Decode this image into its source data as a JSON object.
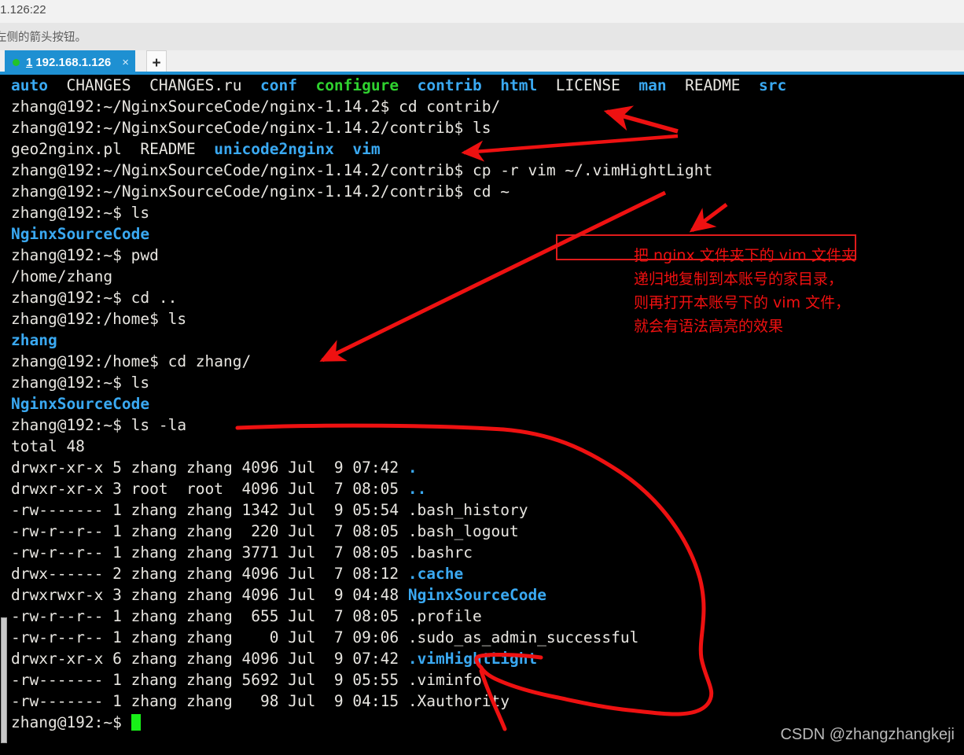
{
  "window": {
    "title_fragment": ".1.126:22",
    "hint_fragment": "左侧的箭头按钮。"
  },
  "tabbar": {
    "status_dot_color": "#22c32a",
    "tab_number": "1",
    "tab_label": "192.168.1.126",
    "close_glyph": "×",
    "new_tab_glyph": "+",
    "active_color": "#1e90d2"
  },
  "terminal": {
    "background": "#000000",
    "foreground": "#e8e6e1",
    "dir_color": "#3aa9f2",
    "exec_color": "#2fd22f",
    "cursor_color": "#18f018",
    "lines": [
      {
        "segs": [
          {
            "t": "auto",
            "c": "dir"
          },
          {
            "t": "  CHANGES  CHANGES.ru  ",
            "c": "plain"
          },
          {
            "t": "conf",
            "c": "dir"
          },
          {
            "t": "  ",
            "c": "plain"
          },
          {
            "t": "configure",
            "c": "exe"
          },
          {
            "t": "  ",
            "c": "plain"
          },
          {
            "t": "contrib",
            "c": "dir"
          },
          {
            "t": "  ",
            "c": "plain"
          },
          {
            "t": "html",
            "c": "dir"
          },
          {
            "t": "  LICENSE  ",
            "c": "plain"
          },
          {
            "t": "man",
            "c": "dir"
          },
          {
            "t": "  README  ",
            "c": "plain"
          },
          {
            "t": "src",
            "c": "dir"
          }
        ]
      },
      {
        "segs": [
          {
            "t": "zhang@192:~/NginxSourceCode/nginx-1.14.2$ cd contrib/",
            "c": "plain"
          }
        ]
      },
      {
        "segs": [
          {
            "t": "zhang@192:~/NginxSourceCode/nginx-1.14.2/contrib$ ls",
            "c": "plain"
          }
        ]
      },
      {
        "segs": [
          {
            "t": "geo2nginx.pl  README  ",
            "c": "plain"
          },
          {
            "t": "unicode2nginx",
            "c": "dir"
          },
          {
            "t": "  ",
            "c": "plain"
          },
          {
            "t": "vim",
            "c": "dir"
          }
        ]
      },
      {
        "segs": [
          {
            "t": "zhang@192:~/NginxSourceCode/nginx-1.14.2/contrib$ cp -r vim ~/.vimHightLight",
            "c": "plain"
          }
        ]
      },
      {
        "segs": [
          {
            "t": "zhang@192:~/NginxSourceCode/nginx-1.14.2/contrib$ cd ~",
            "c": "plain"
          }
        ]
      },
      {
        "segs": [
          {
            "t": "zhang@192:~$ ls",
            "c": "plain"
          }
        ]
      },
      {
        "segs": [
          {
            "t": "NginxSourceCode",
            "c": "dir"
          }
        ]
      },
      {
        "segs": [
          {
            "t": "zhang@192:~$ pwd",
            "c": "plain"
          }
        ]
      },
      {
        "segs": [
          {
            "t": "/home/zhang",
            "c": "plain"
          }
        ]
      },
      {
        "segs": [
          {
            "t": "zhang@192:~$ cd ..",
            "c": "plain"
          }
        ]
      },
      {
        "segs": [
          {
            "t": "zhang@192:/home$ ls",
            "c": "plain"
          }
        ]
      },
      {
        "segs": [
          {
            "t": "zhang",
            "c": "dir"
          }
        ]
      },
      {
        "segs": [
          {
            "t": "zhang@192:/home$ cd zhang/",
            "c": "plain"
          }
        ]
      },
      {
        "segs": [
          {
            "t": "zhang@192:~$ ls",
            "c": "plain"
          }
        ]
      },
      {
        "segs": [
          {
            "t": "NginxSourceCode",
            "c": "dir"
          }
        ]
      },
      {
        "segs": [
          {
            "t": "zhang@192:~$ ls -la",
            "c": "plain"
          }
        ]
      },
      {
        "segs": [
          {
            "t": "total 48",
            "c": "plain"
          }
        ]
      },
      {
        "segs": [
          {
            "t": "drwxr-xr-x 5 zhang zhang 4096 Jul  9 07:42 ",
            "c": "plain"
          },
          {
            "t": ".",
            "c": "dir"
          }
        ]
      },
      {
        "segs": [
          {
            "t": "drwxr-xr-x 3 root  root  4096 Jul  7 08:05 ",
            "c": "plain"
          },
          {
            "t": "..",
            "c": "dir"
          }
        ]
      },
      {
        "segs": [
          {
            "t": "-rw------- 1 zhang zhang 1342 Jul  9 05:54 .bash_history",
            "c": "plain"
          }
        ]
      },
      {
        "segs": [
          {
            "t": "-rw-r--r-- 1 zhang zhang  220 Jul  7 08:05 .bash_logout",
            "c": "plain"
          }
        ]
      },
      {
        "segs": [
          {
            "t": "-rw-r--r-- 1 zhang zhang 3771 Jul  7 08:05 .bashrc",
            "c": "plain"
          }
        ]
      },
      {
        "segs": [
          {
            "t": "drwx------ 2 zhang zhang 4096 Jul  7 08:12 ",
            "c": "plain"
          },
          {
            "t": ".cache",
            "c": "dir"
          }
        ]
      },
      {
        "segs": [
          {
            "t": "drwxrwxr-x 3 zhang zhang 4096 Jul  9 04:48 ",
            "c": "plain"
          },
          {
            "t": "NginxSourceCode",
            "c": "dir"
          }
        ]
      },
      {
        "segs": [
          {
            "t": "-rw-r--r-- 1 zhang zhang  655 Jul  7 08:05 .profile",
            "c": "plain"
          }
        ]
      },
      {
        "segs": [
          {
            "t": "-rw-r--r-- 1 zhang zhang    0 Jul  7 09:06 .sudo_as_admin_successful",
            "c": "plain"
          }
        ]
      },
      {
        "segs": [
          {
            "t": "drwxr-xr-x 6 zhang zhang 4096 Jul  9 07:42 ",
            "c": "plain"
          },
          {
            "t": ".vimHightLight",
            "c": "dir"
          }
        ]
      },
      {
        "segs": [
          {
            "t": "-rw------- 1 zhang zhang 5692 Jul  9 05:55 .viminfo",
            "c": "plain"
          }
        ]
      },
      {
        "segs": [
          {
            "t": "-rw------- 1 zhang zhang   98 Jul  9 04:15 .Xauthority",
            "c": "plain"
          }
        ]
      },
      {
        "segs": [
          {
            "t": "zhang@192:~$ ",
            "c": "plain"
          },
          {
            "t": "",
            "c": "cursor"
          }
        ]
      }
    ]
  },
  "annotations": {
    "color": "#f01010",
    "highlight_box_command": "cp -r vim ~/.vimHightLight",
    "note_lines": [
      "把 nginx 文件夹下的 vim 文件夹",
      "递归地复制到本账号的家目录，",
      "则再打开本账号下的 vim 文件，",
      "就会有语法高亮的效果"
    ],
    "arrow_targets": [
      "cd contrib/",
      "vim",
      "cp -r vim ~/.vimHightLight",
      "cd zhang/",
      ".vimHightLight"
    ]
  },
  "watermark": {
    "text": "CSDN @zhangzhangkeji"
  }
}
